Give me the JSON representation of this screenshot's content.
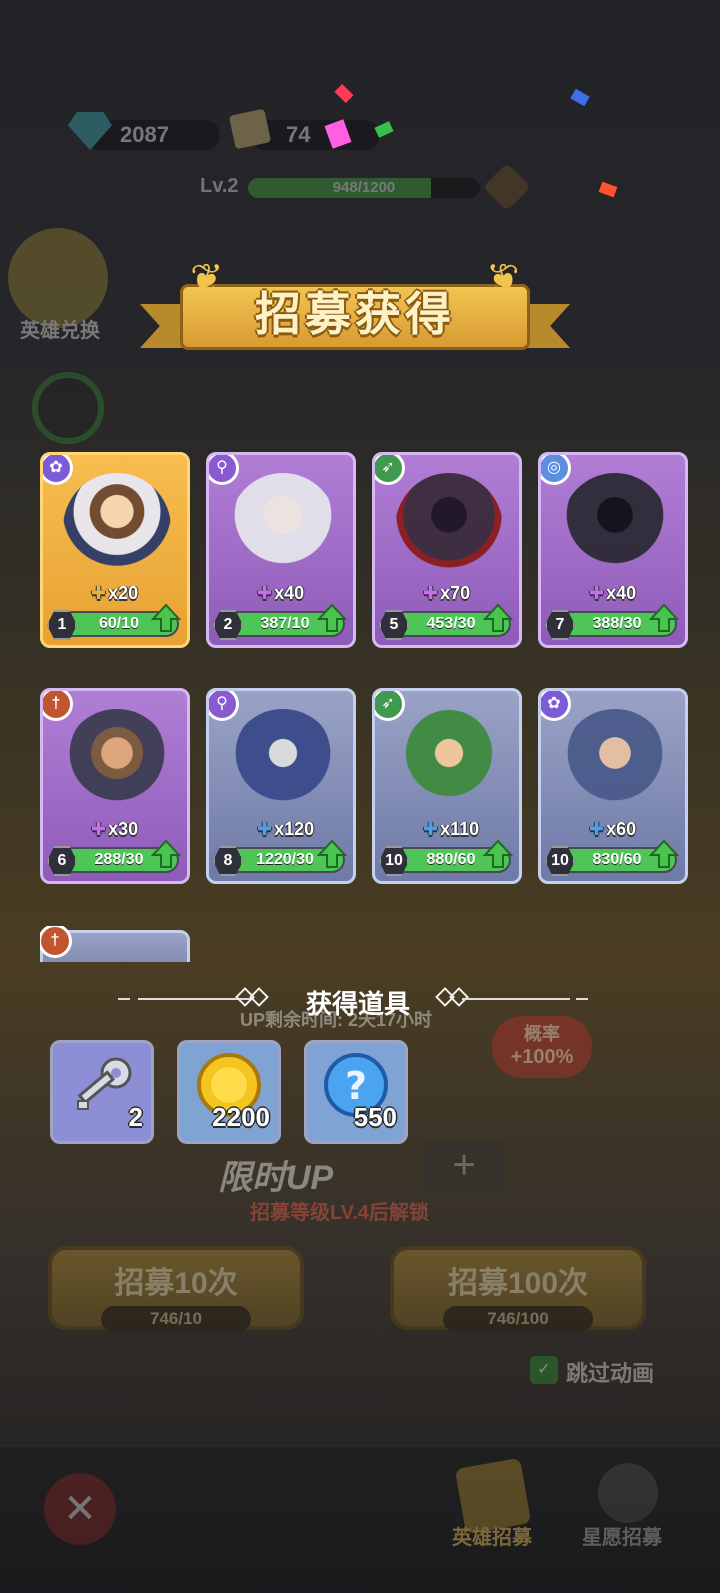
{
  "top_bar": {
    "gems": "2087",
    "tickets": "74",
    "level": "Lv.2",
    "xp_text": "948/1200",
    "xp_progress": 0.79
  },
  "side_menu": {
    "exchange_label": "英雄兑换"
  },
  "background": {
    "up_time_text": "UP剩余时间: 2天17小时",
    "probability_label": "概率",
    "probability_value": "+100%",
    "limited_up_label": "限时UP",
    "unlock_text": "招募等级LV.4后解锁",
    "recruit_10_label": "招募10次",
    "recruit_10_cost": "746/10",
    "recruit_100_label": "招募100次",
    "recruit_100_cost": "746/100",
    "skip_animation_label": "跳过动画"
  },
  "bottom_nav": {
    "hero_recruit": "英雄招募",
    "wish_recruit": "星愿招募"
  },
  "result": {
    "title": "招募获得",
    "heroes": [
      {
        "rarity": "gold",
        "class_icon": "paw-icon",
        "class_color": "#7b5bd6",
        "fragments": "x20",
        "star": "1",
        "progress_text": "60/10",
        "progress": 1.0,
        "portrait": "boy-hero"
      },
      {
        "rarity": "purple",
        "class_icon": "staff-icon",
        "class_color": "#8a5bd0",
        "fragments": "x40",
        "star": "2",
        "progress_text": "387/10",
        "progress": 1.0,
        "portrait": "white-wizard"
      },
      {
        "rarity": "purple",
        "class_icon": "bow-icon",
        "class_color": "#3f9a4f",
        "fragments": "x70",
        "star": "5",
        "progress_text": "453/30",
        "progress": 1.0,
        "portrait": "hooded-archer"
      },
      {
        "rarity": "purple",
        "class_icon": "swirl-icon",
        "class_color": "#5c8fe0",
        "fragments": "x40",
        "star": "7",
        "progress_text": "388/30",
        "progress": 1.0,
        "portrait": "dark-reaper"
      },
      {
        "rarity": "purple",
        "class_icon": "sword-icon",
        "class_color": "#c0552f",
        "fragments": "x30",
        "star": "6",
        "progress_text": "288/30",
        "progress": 1.0,
        "portrait": "axe-warrior"
      },
      {
        "rarity": "blue",
        "class_icon": "staff-icon",
        "class_color": "#8a5bd0",
        "fragments": "x120",
        "star": "8",
        "progress_text": "1220/30",
        "progress": 1.0,
        "portrait": "blue-wizard"
      },
      {
        "rarity": "blue",
        "class_icon": "bow-icon",
        "class_color": "#3f9a4f",
        "fragments": "x110",
        "star": "10",
        "progress_text": "880/60",
        "progress": 1.0,
        "portrait": "green-archer"
      },
      {
        "rarity": "blue",
        "class_icon": "paw-icon",
        "class_color": "#7b5bd6",
        "fragments": "x60",
        "star": "10",
        "progress_text": "830/60",
        "progress": 1.0,
        "portrait": "shield-knight"
      }
    ],
    "items_title": "获得道具",
    "items": [
      {
        "icon": "key-icon",
        "count": "2",
        "bg": "#8d8fd6"
      },
      {
        "icon": "gold-coin-icon",
        "count": "2200",
        "bg": "#7fa3d2"
      },
      {
        "icon": "mystery-orb-icon",
        "count": "550",
        "bg": "#7fa3d2"
      }
    ]
  }
}
